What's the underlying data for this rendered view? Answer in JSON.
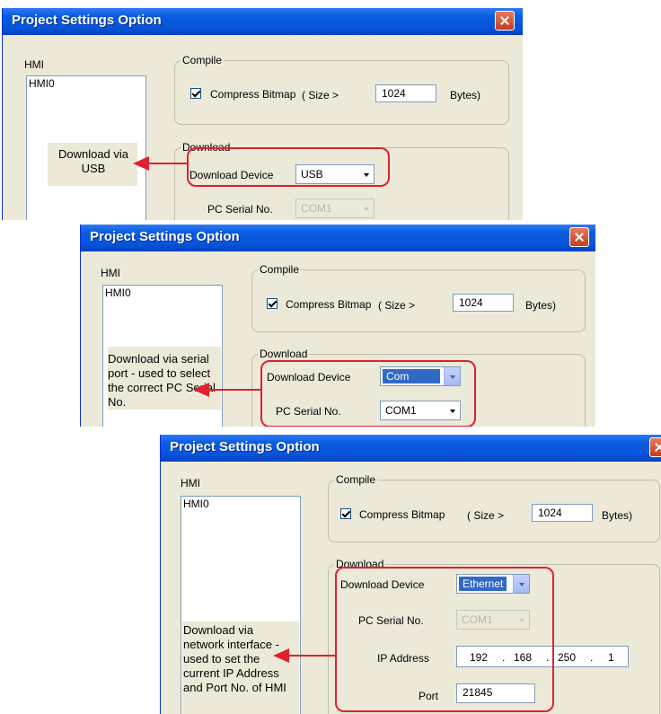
{
  "dialogs": [
    {
      "title": "Project Settings Option",
      "hmi_label": "HMI",
      "hmi_item": "HMI0",
      "compile": {
        "title": "Compile",
        "checkbox_label": "Compress Bitmap",
        "size_label": "( Size >",
        "size_value": "1024",
        "bytes_label": "Bytes)"
      },
      "download": {
        "title": "Download",
        "device_label": "Download Device",
        "device_value": "USB",
        "serial_label": "PC Serial No.",
        "serial_value": "COM1"
      },
      "callout": "Download via USB"
    },
    {
      "title": "Project Settings Option",
      "hmi_label": "HMI",
      "hmi_item": "HMI0",
      "compile": {
        "title": "Compile",
        "checkbox_label": "Compress Bitmap",
        "size_label": "( Size >",
        "size_value": "1024",
        "bytes_label": "Bytes)"
      },
      "download": {
        "title": "Download",
        "device_label": "Download Device",
        "device_value": "Com",
        "serial_label": "PC Serial No.",
        "serial_value": "COM1"
      },
      "callout": "Download via serial port - used to select the correct PC Serial No."
    },
    {
      "title": "Project Settings Option",
      "hmi_label": "HMI",
      "hmi_item": "HMI0",
      "compile": {
        "title": "Compile",
        "checkbox_label": "Compress Bitmap",
        "size_label": "( Size >",
        "size_value": "1024",
        "bytes_label": "Bytes)"
      },
      "download": {
        "title": "Download",
        "device_label": "Download Device",
        "device_value": "Ethernet",
        "serial_label": "PC Serial No.",
        "serial_value": "COM1",
        "ip_label": "IP Address",
        "ip_values": [
          "192",
          "168",
          "250",
          "1"
        ],
        "port_label": "Port",
        "port_value": "21845"
      },
      "callout": "Download via network interface - used to set the current IP Address and Port No. of HMI"
    }
  ],
  "colors": {
    "highlight": "#e0202e",
    "titlebar": "#0855dd",
    "dialog_bg": "#ece9d8"
  }
}
